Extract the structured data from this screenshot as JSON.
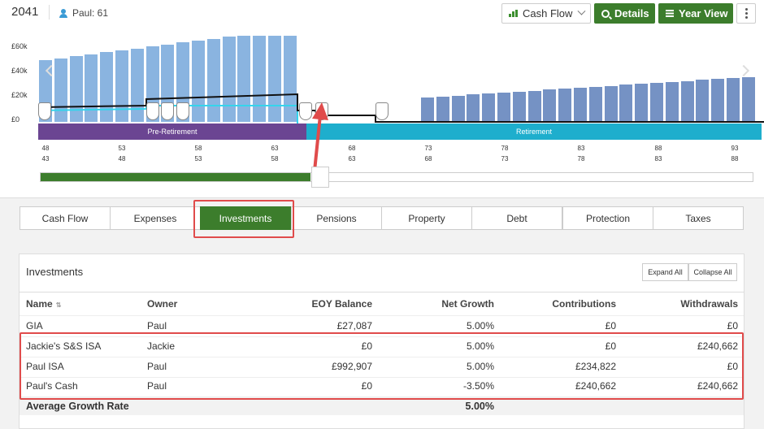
{
  "header": {
    "year": "2041",
    "person_label": "Paul: 61",
    "view_select": "Cash Flow",
    "details_label": "Details",
    "year_view_label": "Year View"
  },
  "chart": {
    "y_labels": [
      "£60k",
      "£40k",
      "£20k",
      "£0"
    ],
    "phases": [
      "Pre-Retirement",
      "Retirement"
    ],
    "ages_row1": [
      "48",
      "53",
      "58",
      "63",
      "68",
      "73",
      "78",
      "83",
      "88",
      "93"
    ],
    "ages_row2": [
      "43",
      "48",
      "53",
      "58",
      "63",
      "68",
      "73",
      "78",
      "83",
      "88"
    ],
    "colors": {
      "pre_bar": "#8ab4e0",
      "post_bar": "#7592c4",
      "pre_phase": "#6b4592",
      "post_phase": "#1eaecd",
      "highlight": "#e04b4b"
    }
  },
  "tabs": [
    "Cash Flow",
    "Expenses",
    "Investments",
    "Pensions",
    "Property",
    "Debt",
    "Protection",
    "Taxes"
  ],
  "active_tab": "Investments",
  "investments": {
    "title": "Investments",
    "expand_all": "Expand All",
    "collapse_all": "Collapse All",
    "columns": [
      "Name",
      "Owner",
      "EOY Balance",
      "Net Growth",
      "Contributions",
      "Withdrawals"
    ],
    "rows": [
      [
        "GIA",
        "Paul",
        "£27,087",
        "5.00%",
        "£0",
        "£0"
      ],
      [
        "Jackie's S&S ISA",
        "Jackie",
        "£0",
        "5.00%",
        "£0",
        "£240,662"
      ],
      [
        "Paul ISA",
        "Paul",
        "£992,907",
        "5.00%",
        "£234,822",
        "£0"
      ],
      [
        "Paul's Cash",
        "Paul",
        "£0",
        "-3.50%",
        "£240,662",
        "£240,662"
      ]
    ],
    "average_label": "Average Growth Rate",
    "average_value": "5.00%"
  }
}
